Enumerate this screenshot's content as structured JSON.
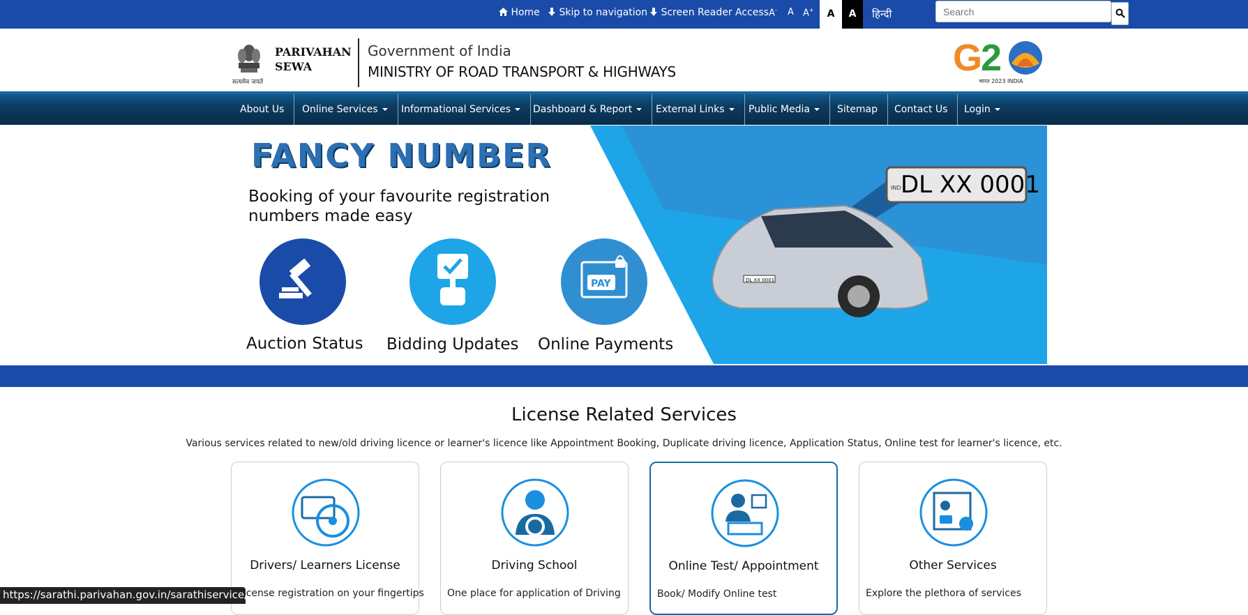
{
  "topbar": {
    "home": "Home",
    "skip": "Skip to navigation",
    "screen_reader": "Screen Reader Access",
    "font_smaller": "A",
    "font_normal": "A",
    "font_larger": "A",
    "contrast_light": "A",
    "contrast_dark": "A",
    "hindi": "हिन्दी",
    "search_placeholder": "Search"
  },
  "header": {
    "brand_line1": "PARIVAHAN",
    "brand_line2": "SEWA",
    "emblem_caption": "सत्यमेव जयते",
    "gov": "Government of India",
    "ministry": "MINISTRY OF ROAD TRANSPORT & HIGHWAYS",
    "g20_sub": "भारत 2023 INDIA"
  },
  "nav": [
    {
      "label": "About Us",
      "dropdown": false
    },
    {
      "label": "Online Services",
      "dropdown": true
    },
    {
      "label": "Informational Services",
      "dropdown": true
    },
    {
      "label": "Dashboard & Report",
      "dropdown": true
    },
    {
      "label": "External Links",
      "dropdown": true
    },
    {
      "label": "Public Media",
      "dropdown": true
    },
    {
      "label": "Sitemap",
      "dropdown": false
    },
    {
      "label": "Contact Us",
      "dropdown": false
    },
    {
      "label": "Login",
      "dropdown": true
    }
  ],
  "banner": {
    "title": "FANCY NUMBER",
    "tagline": "Booking of your favourite registration numbers made easy",
    "plate": "DL XX 0001",
    "plate_small": "DL XX 0001",
    "plate_ind": "IND",
    "features": [
      "Auction Status",
      "Bidding Updates",
      "Online Payments"
    ],
    "pay_label": "PAY"
  },
  "license": {
    "title": "License Related Services",
    "description": "Various services related to new/old driving licence or learner's licence like Appointment Booking, Duplicate driving licence, Application Status, Online test for learner's licence, etc.",
    "cards": [
      {
        "title": "Drivers/ Learners License",
        "desc": "License registration on your fingertips"
      },
      {
        "title": "Driving School",
        "desc": "One place for application of Driving"
      },
      {
        "title": "Online Test/ Appointment",
        "desc": "Book/ Modify Online test"
      },
      {
        "title": "Other Services",
        "desc": "Explore the plethora of services"
      }
    ]
  },
  "status_url": "https://sarathi.parivahan.gov.in/sarathiservice/",
  "colors": {
    "topbar": "#1a4ba8",
    "nav": "#0d3b60",
    "accent": "#2c6fb3",
    "banner_blue": "#1ea5e8"
  }
}
